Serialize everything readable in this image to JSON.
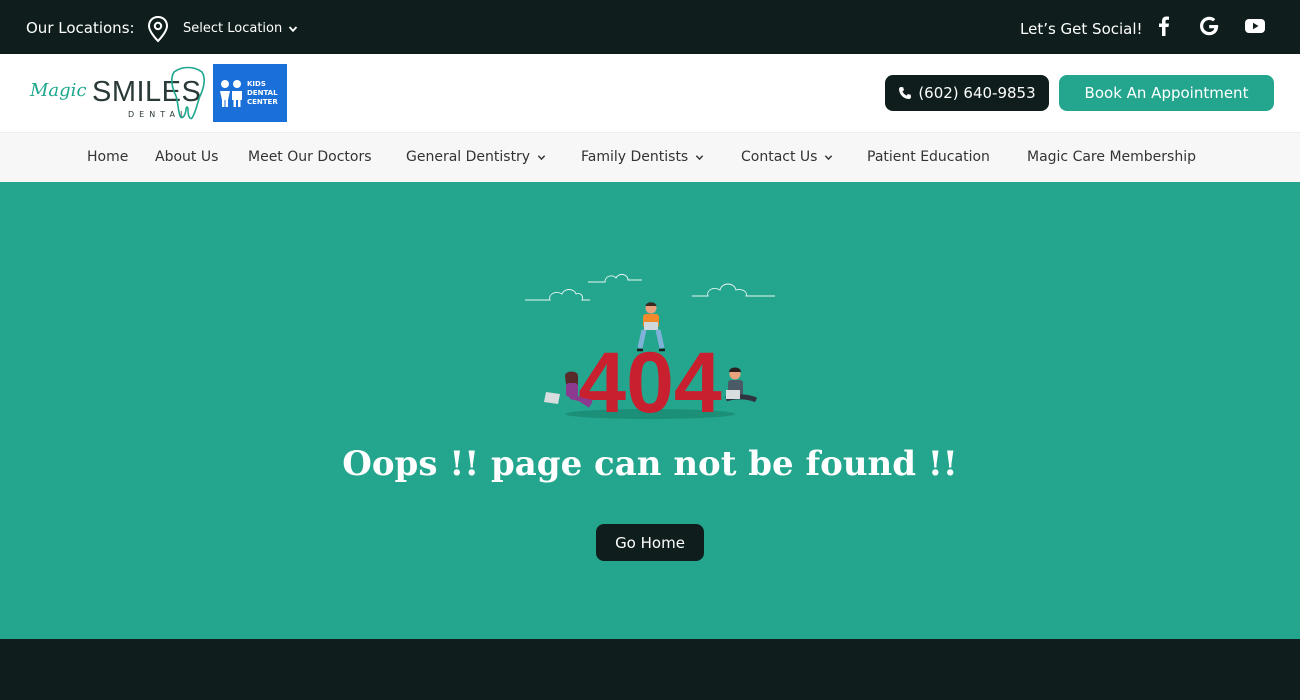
{
  "topbar": {
    "locations_label": "Our Locations:",
    "location_select": "Select Location",
    "social_label": "Let’s Get Social!"
  },
  "header": {
    "logo_script": "Magic",
    "logo_main": "SMILES",
    "logo_sub": "DENTAL",
    "kids_badge": [
      "KIDS",
      "DENTAL",
      "CENTER"
    ],
    "phone": "(602) 640-9853",
    "appointment": "Book An Appointment"
  },
  "nav": {
    "items": [
      {
        "label": "Home"
      },
      {
        "label": "About Us"
      },
      {
        "label": "Meet Our Doctors"
      },
      {
        "label": "General Dentistry",
        "dropdown": true
      },
      {
        "label": "Family Dentists",
        "dropdown": true
      },
      {
        "label": "Contact Us",
        "dropdown": true
      },
      {
        "label": "Patient Education"
      },
      {
        "label": "Magic Care Membership"
      }
    ]
  },
  "main": {
    "error_code": "404",
    "message": "Oops !! page can not be found !!",
    "go_home": "Go Home"
  },
  "colors": {
    "dark": "#0f1e1c",
    "teal": "#23a68d",
    "error_red": "#c8202f",
    "kids_blue": "#1a6fd8"
  }
}
